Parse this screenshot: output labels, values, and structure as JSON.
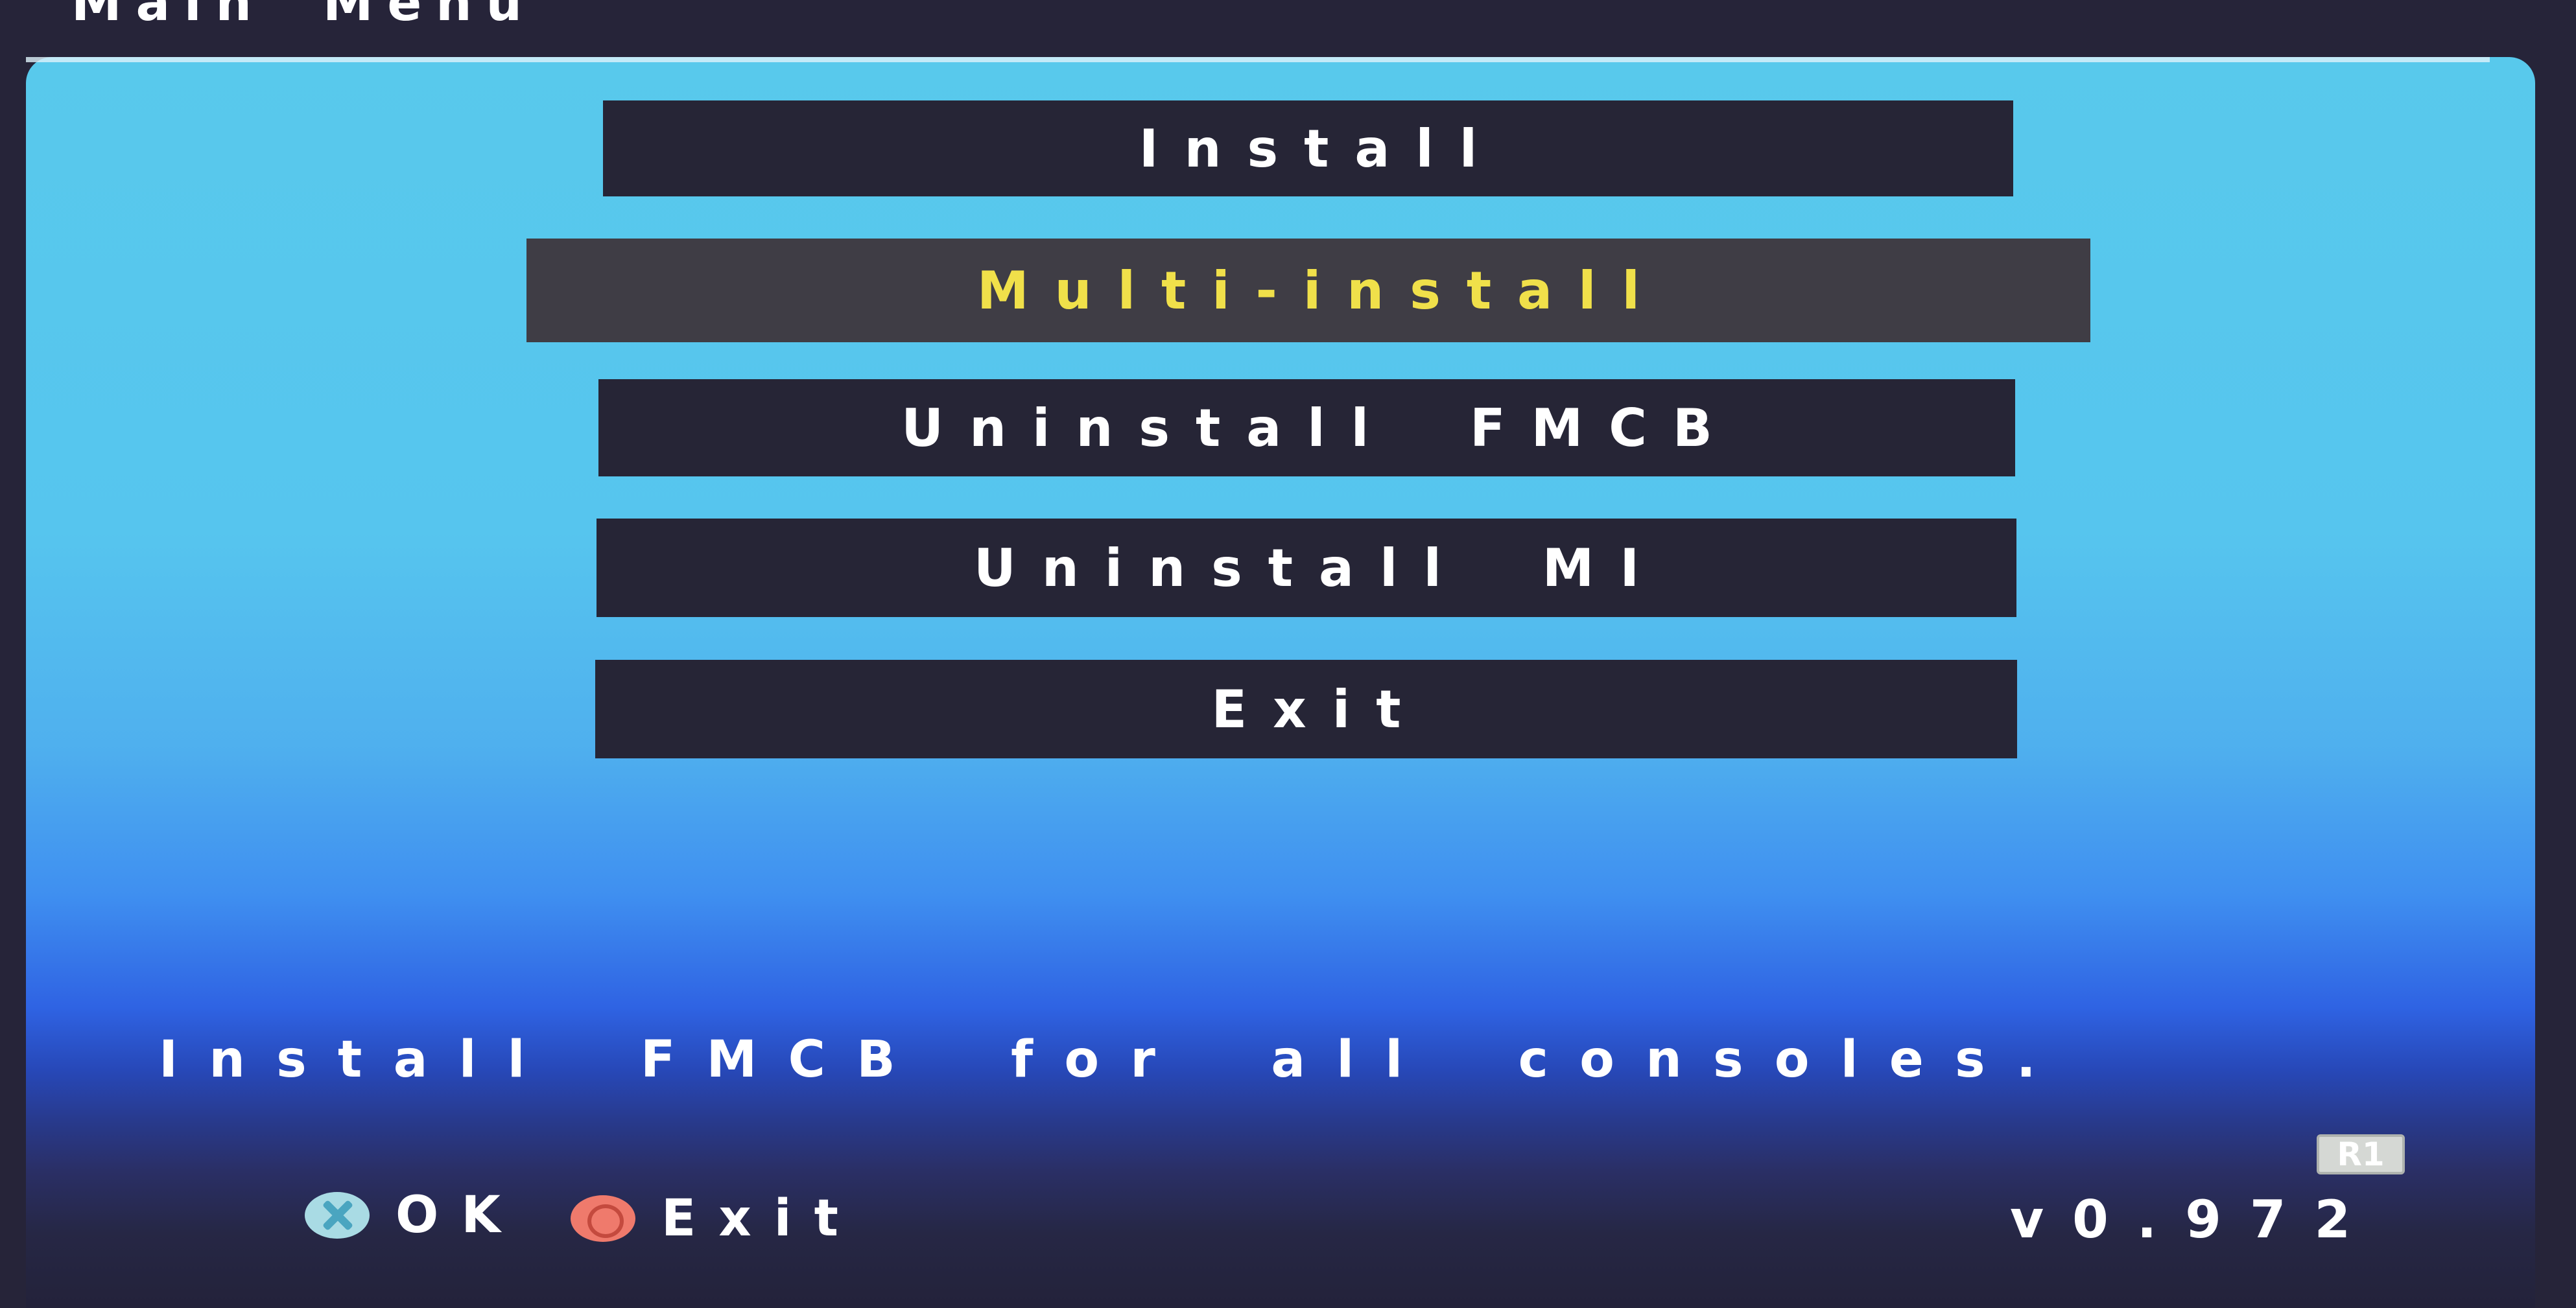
{
  "header": {
    "title": "Main Menu"
  },
  "menu": {
    "items": [
      {
        "label": "Install",
        "selected": false
      },
      {
        "label": "Multi-install",
        "selected": true
      },
      {
        "label": "Uninstall FMCB",
        "selected": false
      },
      {
        "label": "Uninstall MI",
        "selected": false
      },
      {
        "label": "Exit",
        "selected": false
      }
    ]
  },
  "description": "Install FMCB for all consoles.",
  "footer": {
    "ok_label": "OK",
    "ok_icon": "cross-button-icon",
    "exit_label": "Exit",
    "exit_icon": "circle-button-icon",
    "r1_label": "R1",
    "version": "v0.972"
  },
  "colors": {
    "selected_text": "#f0e04a",
    "item_text": "#ffffff",
    "item_bg": "#262536",
    "selected_bg": "#3f3d45"
  }
}
